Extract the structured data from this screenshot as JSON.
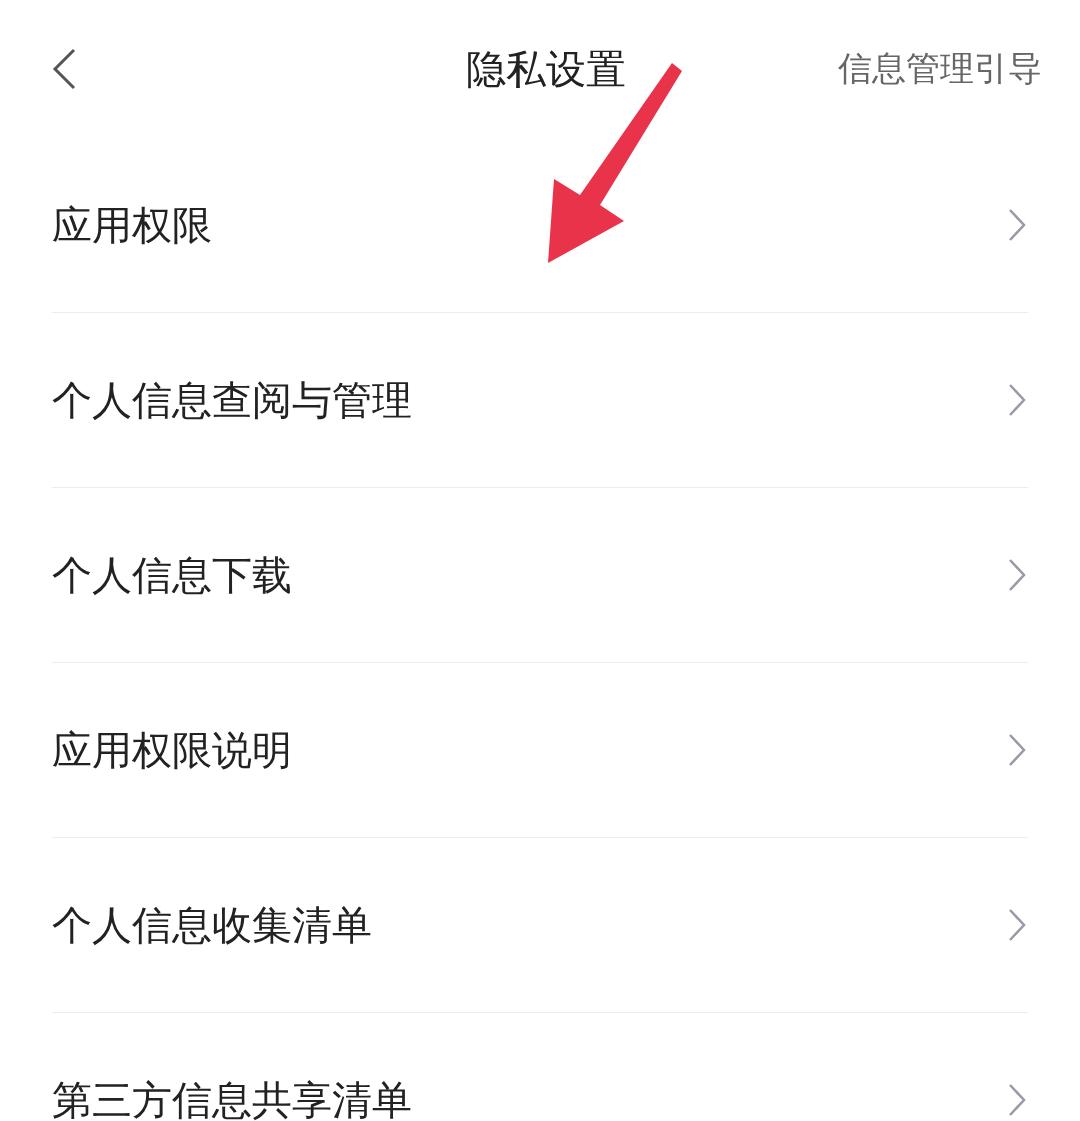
{
  "header": {
    "title": "隐私设置",
    "action": "信息管理引导"
  },
  "items": [
    {
      "label": "应用权限"
    },
    {
      "label": "个人信息查阅与管理"
    },
    {
      "label": "个人信息下载"
    },
    {
      "label": "应用权限说明"
    },
    {
      "label": "个人信息收集清单"
    },
    {
      "label": "第三方信息共享清单"
    }
  ]
}
